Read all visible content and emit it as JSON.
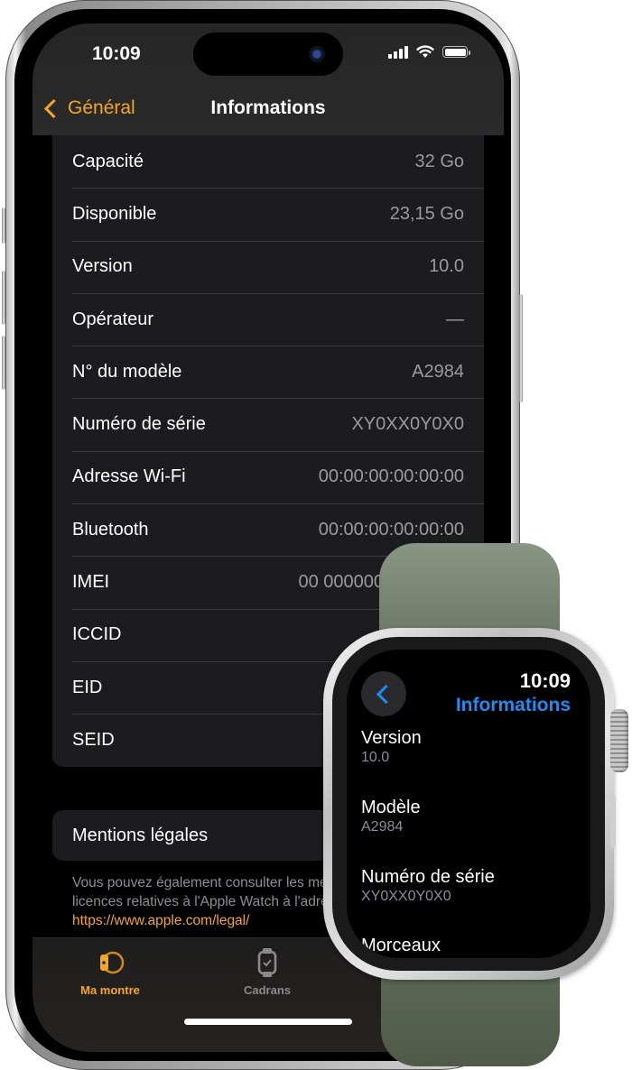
{
  "phone": {
    "status_bar": {
      "time": "10:09",
      "signal_icon": "cellular-signal-icon",
      "wifi_icon": "wifi-icon",
      "battery_icon": "battery-icon"
    },
    "nav": {
      "back_label": "Général",
      "title": "Informations"
    },
    "info_rows": [
      {
        "label": "Capacité",
        "value": "32 Go"
      },
      {
        "label": "Disponible",
        "value": "23,15 Go"
      },
      {
        "label": "Version",
        "value": "10.0"
      },
      {
        "label": "Opérateur",
        "value": "—"
      },
      {
        "label": "N° du modèle",
        "value": "A2984"
      },
      {
        "label": "Numéro de série",
        "value": "XY0XX0Y0X0"
      },
      {
        "label": "Adresse Wi-Fi",
        "value": "00:00:00:00:00:00"
      },
      {
        "label": "Bluetooth",
        "value": "00:00:00:00:00:00"
      },
      {
        "label": "IMEI",
        "value": "00 000000 000000 0"
      },
      {
        "label": "ICCID",
        "value": ""
      },
      {
        "label": "EID",
        "value": ""
      },
      {
        "label": "SEID",
        "value": ""
      }
    ],
    "legal": {
      "label": "Mentions légales",
      "note": "Vous pouvez également consulter les mentions légales et les licences relatives à l'Apple Watch à l'adresse",
      "link": "https://www.apple.com/legal/"
    },
    "tabs": [
      {
        "label": "Ma montre",
        "icon": "my-watch-icon",
        "active": true
      },
      {
        "label": "Cadrans",
        "icon": "watch-faces-icon",
        "active": false
      }
    ],
    "accent_color": "#f5a623"
  },
  "watch": {
    "time": "10:09",
    "title": "Informations",
    "back_icon": "chevron-left-icon",
    "items": [
      {
        "label": "Version",
        "value": "10.0"
      },
      {
        "label": "Modèle",
        "value": "A2984"
      },
      {
        "label": "Numéro de série",
        "value": "XY0XX0Y0X0"
      },
      {
        "label": "Morceaux",
        "value": ""
      }
    ],
    "accent_color": "#1e8cf0",
    "band_color": "#6b7764"
  }
}
